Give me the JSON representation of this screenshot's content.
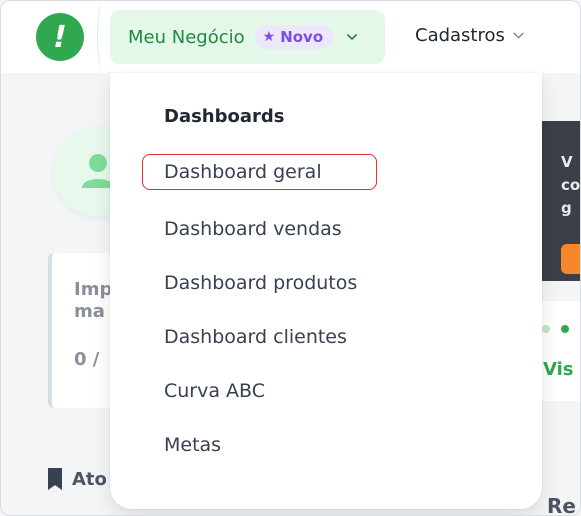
{
  "nav": {
    "logo_glyph": "!",
    "active": {
      "label": "Meu Negócio",
      "badge": "Novo",
      "badge_icon": "star-icon"
    },
    "secondary": {
      "label": "Cadastros"
    }
  },
  "dropdown": {
    "heading": "Dashboards",
    "items": [
      {
        "label": "Dashboard geral",
        "highlighted": true
      },
      {
        "label": "Dashboard vendas"
      },
      {
        "label": "Dashboard produtos"
      },
      {
        "label": "Dashboard clientes"
      },
      {
        "label": "Curva ABC"
      },
      {
        "label": "Metas"
      }
    ]
  },
  "background": {
    "card_title": "Imp ma",
    "card_count": "0 / ",
    "section_label": "Ato",
    "dark_card_text": "V co g",
    "visit_link": "Vis",
    "right_section": "Re"
  },
  "colors": {
    "brand_green": "#2fa84f",
    "active_bg": "#e3f8e9",
    "badge_purple": "#7a4fe0",
    "highlight_red": "#e03131",
    "accent_orange": "#f6872b"
  }
}
